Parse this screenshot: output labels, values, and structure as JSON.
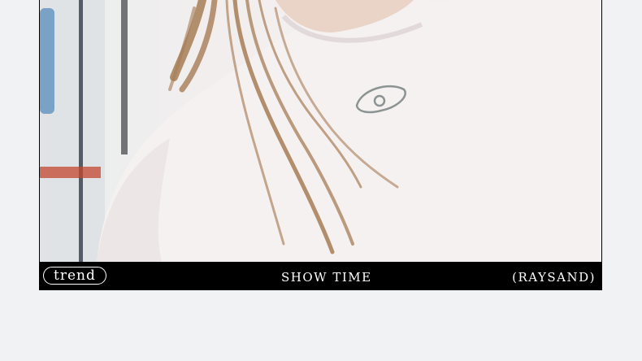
{
  "photo": {
    "subject": "person in white t-shirt with long brown hair",
    "tshirt_color": "#f6f1f1",
    "hair_color": "#a67c55"
  },
  "caption": {
    "left_badge": "trend",
    "center": "SHOW TIME",
    "right": "(RAYSAND)"
  },
  "colors": {
    "page_background": "#f1f2f4",
    "caption_bar": "#000000",
    "caption_text": "#ffffff"
  }
}
